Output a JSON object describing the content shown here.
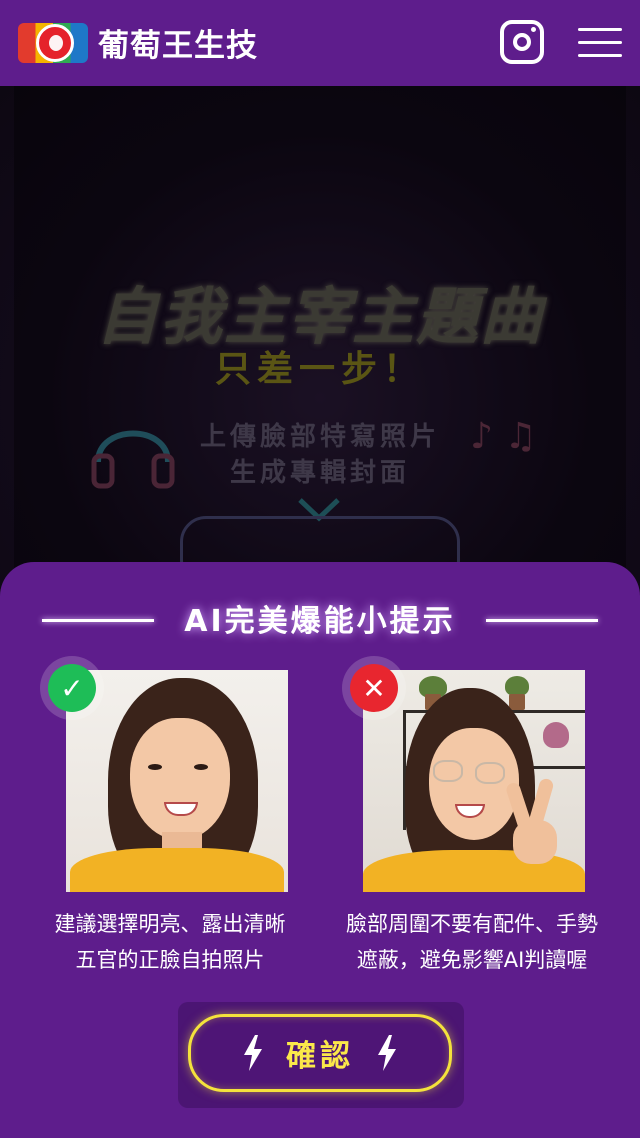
{
  "header": {
    "brand_name": "葡萄王生技",
    "icons": {
      "logo": "grape-king-logo-icon",
      "instagram": "instagram-icon",
      "menu": "hamburger-menu-icon"
    }
  },
  "hero": {
    "title": "自我主宰主題曲",
    "subtitle": "只差一步！",
    "line1": "上傳臉部特寫照片",
    "line2": "生成專輯封面",
    "icons": [
      "headphones-icon",
      "music-notes-icon",
      "chevron-down-icon"
    ]
  },
  "tips_modal": {
    "title": "AI完美爆能小提示",
    "good_example": {
      "badge": "✓",
      "caption_line1": "建議選擇明亮、露出清晰",
      "caption_line2": "五官的正臉自拍照片",
      "badge_color": "#1ebd57"
    },
    "bad_example": {
      "badge": "✕",
      "caption_line1": "臉部周圍不要有配件、手勢",
      "caption_line2": "遮蔽，避免影響AI判讀喔",
      "badge_color": "#e8262f"
    },
    "confirm_label": "確認"
  },
  "colors": {
    "brand_purple": "#5e1d8c",
    "accent_yellow": "#f4e23c",
    "hero_bg": "#120a1a"
  }
}
